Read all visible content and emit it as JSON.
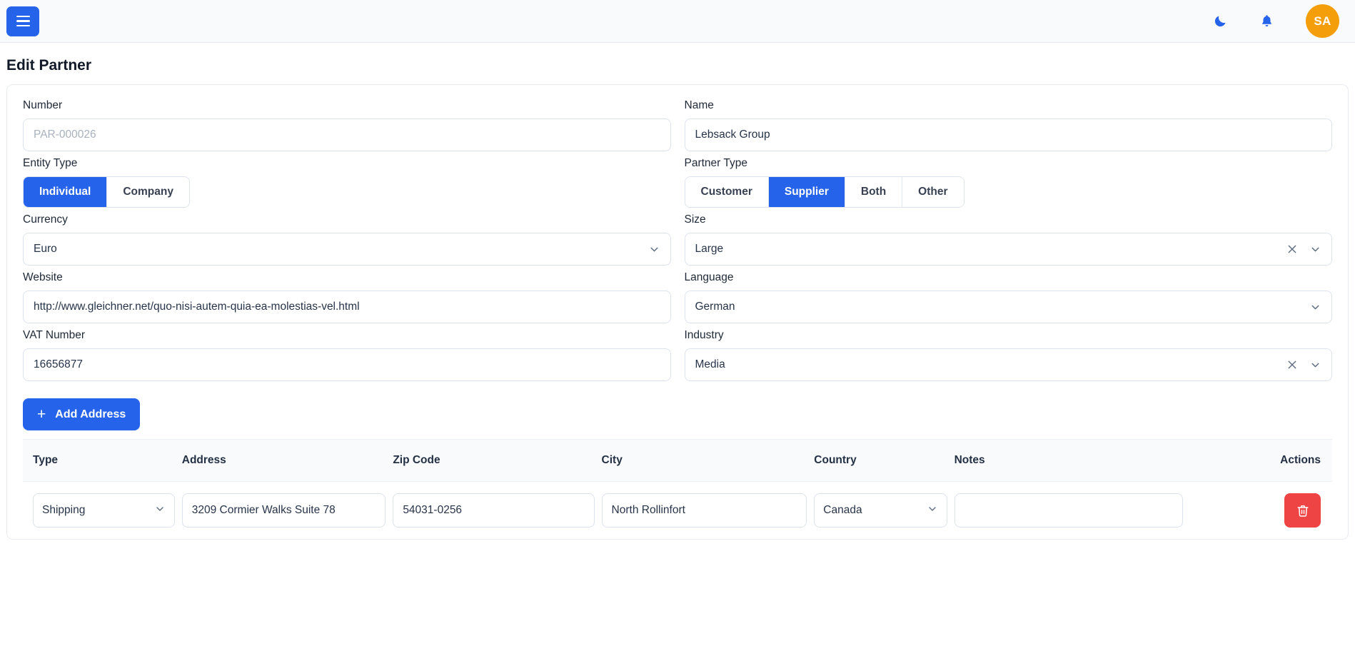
{
  "topbar": {
    "menu_icon": "hamburger-icon",
    "theme_icon": "moon-icon",
    "notifications_icon": "bell-icon",
    "avatar_initials": "SA",
    "avatar_color": "#f59e0b",
    "accent_color": "#2563eb"
  },
  "page": {
    "title": "Edit Partner"
  },
  "form": {
    "number": {
      "label": "Number",
      "value": "",
      "placeholder": "PAR-000026"
    },
    "name": {
      "label": "Name",
      "value": "Lebsack Group",
      "placeholder": ""
    },
    "entity_type": {
      "label": "Entity Type",
      "options": [
        "Individual",
        "Company"
      ],
      "selected": "Individual"
    },
    "partner_type": {
      "label": "Partner Type",
      "options": [
        "Customer",
        "Supplier",
        "Both",
        "Other"
      ],
      "selected": "Supplier"
    },
    "currency": {
      "label": "Currency",
      "value": "Euro",
      "clearable": false
    },
    "size": {
      "label": "Size",
      "value": "Large",
      "clearable": true
    },
    "website": {
      "label": "Website",
      "value": "http://www.gleichner.net/quo-nisi-autem-quia-ea-molestias-vel.html",
      "placeholder": ""
    },
    "language": {
      "label": "Language",
      "value": "German",
      "clearable": false
    },
    "vat_number": {
      "label": "VAT Number",
      "value": "16656877",
      "placeholder": ""
    },
    "industry": {
      "label": "Industry",
      "value": "Media",
      "clearable": true
    }
  },
  "addresses": {
    "add_button_label": "Add Address",
    "add_button_icon": "plus-icon",
    "columns": [
      "Type",
      "Address",
      "Zip Code",
      "City",
      "Country",
      "Notes",
      "Actions"
    ],
    "rows": [
      {
        "type": "Shipping",
        "address": "3209 Cormier Walks Suite 78",
        "zip_code": "54031-0256",
        "city": "North Rollinfort",
        "country": "Canada",
        "notes": "",
        "delete_icon": "trash-icon",
        "delete_color": "#ef4444"
      }
    ]
  }
}
